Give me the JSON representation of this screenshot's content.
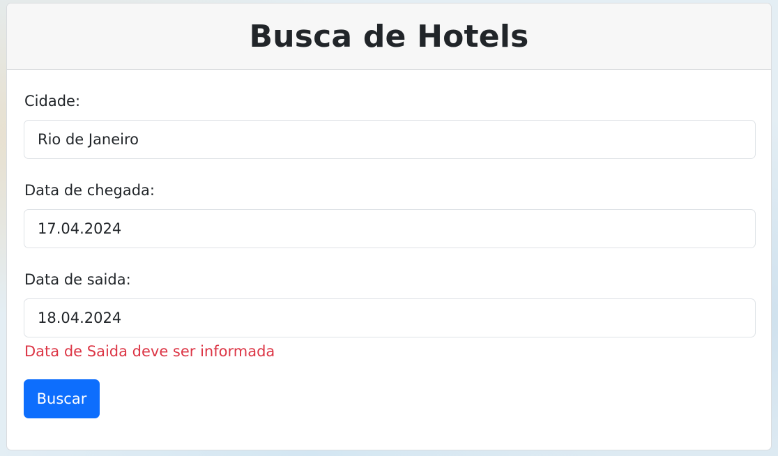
{
  "header": {
    "title": "Busca de Hotels"
  },
  "form": {
    "city": {
      "label": "Cidade:",
      "value": "Rio de Janeiro"
    },
    "checkin": {
      "label": "Data de chegada:",
      "value": "17.04.2024"
    },
    "checkout": {
      "label": "Data de saida:",
      "value": "18.04.2024",
      "error": "Data de Saida deve ser informada"
    },
    "submit_label": "Buscar"
  },
  "colors": {
    "primary": "#0d6efd",
    "error": "#dc3545",
    "header_bg": "#f7f7f7"
  }
}
